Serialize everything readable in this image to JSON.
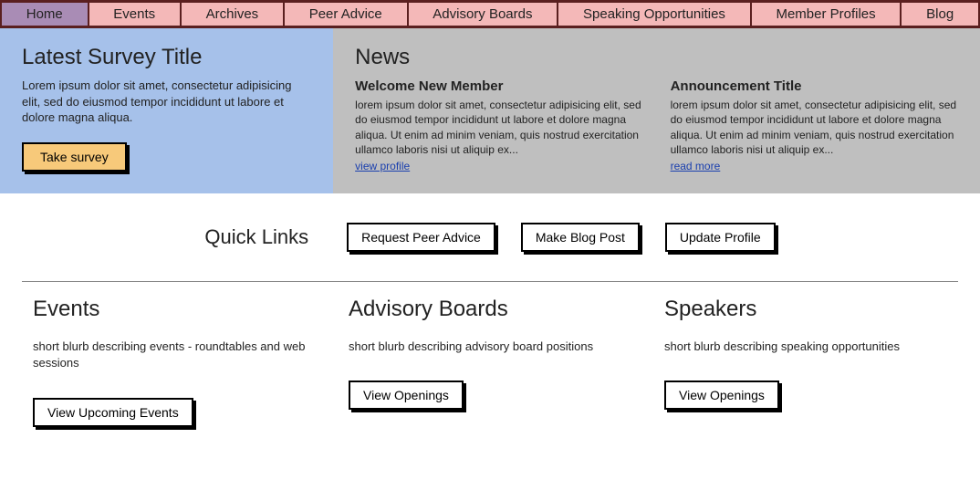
{
  "nav": {
    "items": [
      {
        "label": "Home",
        "active": true
      },
      {
        "label": "Events"
      },
      {
        "label": "Archives"
      },
      {
        "label": "Peer Advice"
      },
      {
        "label": "Advisory Boards"
      },
      {
        "label": "Speaking Opportunities"
      },
      {
        "label": "Member Profiles"
      },
      {
        "label": "Blog"
      }
    ]
  },
  "survey": {
    "title": "Latest Survey Title",
    "body": "Lorem ipsum dolor sit amet, consectetur adipisicing elit, sed do eiusmod tempor incididunt ut labore et dolore magna aliqua.",
    "cta": "Take survey"
  },
  "news": {
    "heading": "News",
    "items": [
      {
        "title": "Welcome New Member",
        "body": "lorem ipsum dolor sit amet, consectetur adipisicing elit, sed do eiusmod tempor incididunt ut labore et dolore magna aliqua. Ut enim ad minim veniam, quis nostrud exercitation ullamco laboris nisi ut aliquip ex...",
        "link_label": "view profile"
      },
      {
        "title": "Announcement Title",
        "body": "lorem ipsum dolor sit amet, consectetur adipisicing elit, sed do eiusmod tempor incididunt ut labore et dolore magna aliqua. Ut enim ad minim veniam, quis nostrud exercitation ullamco laboris nisi ut aliquip ex...",
        "link_label": "read more"
      }
    ]
  },
  "quicklinks": {
    "heading": "Quick Links",
    "buttons": [
      {
        "label": "Request Peer Advice"
      },
      {
        "label": "Make Blog Post"
      },
      {
        "label": "Update Profile"
      }
    ]
  },
  "columns": [
    {
      "title": "Events",
      "blurb": "short blurb describing events - roundtables and web sessions",
      "button": "View Upcoming Events"
    },
    {
      "title": "Advisory Boards",
      "blurb": "short blurb describing advisory board positions",
      "button": "View Openings"
    },
    {
      "title": "Speakers",
      "blurb": "short blurb describing speaking opportunities",
      "button": "View Openings"
    }
  ]
}
